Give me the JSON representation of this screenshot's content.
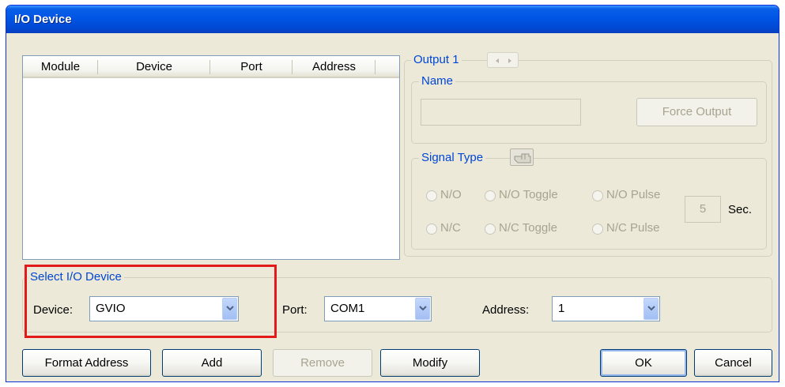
{
  "window": {
    "title": "I/O Device"
  },
  "list": {
    "columns": [
      "Module",
      "Device",
      "Port",
      "Address"
    ],
    "rows": []
  },
  "output": {
    "group_label": "Output 1",
    "nav_icon": "left-right-arrows-icon",
    "name_label": "Name",
    "name_value": "",
    "force_button": "Force Output",
    "signal_type_label": "Signal Type",
    "signal_icon": "pointing-hand-icon",
    "radios": {
      "no": "N/O",
      "no_toggle": "N/O Toggle",
      "no_pulse": "N/O Pulse",
      "nc": "N/C",
      "nc_toggle": "N/C Toggle",
      "nc_pulse": "N/C Pulse"
    },
    "pulse_seconds": "5",
    "seconds_label": "Sec."
  },
  "select_device": {
    "group_label": "Select I/O Device",
    "device_label": "Device:",
    "device_value": "GVIO",
    "port_label": "Port:",
    "port_value": "COM1",
    "address_label": "Address:",
    "address_value": "1"
  },
  "buttons": {
    "format_address": "Format Address",
    "add": "Add",
    "remove": "Remove",
    "modify": "Modify",
    "ok": "OK",
    "cancel": "Cancel"
  },
  "colors": {
    "title_bar": "#0055e5",
    "group_label": "#0046d5",
    "highlight": "#e21a1a",
    "dialog_bg": "#ece9d8"
  }
}
